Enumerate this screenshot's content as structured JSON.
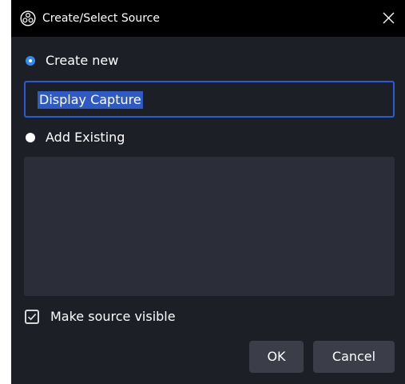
{
  "window": {
    "title": "Create/Select Source",
    "icon": "obs-logo-icon",
    "close_icon": "close-icon"
  },
  "options": {
    "create_new_label": "Create new",
    "create_new_selected": true,
    "add_existing_label": "Add Existing",
    "add_existing_selected": false
  },
  "name_input": {
    "value": "Display Capture"
  },
  "existing_sources": [],
  "visibility": {
    "label": "Make source visible",
    "checked": true
  },
  "buttons": {
    "ok_label": "OK",
    "cancel_label": "Cancel"
  },
  "colors": {
    "background": "#1d1f26",
    "titlebar": "#000000",
    "accent": "#2f8df0",
    "input_border": "#2a5bd6",
    "selection": "#2f59c4",
    "list_background": "#2b2e38",
    "button": "#3b3e48"
  }
}
